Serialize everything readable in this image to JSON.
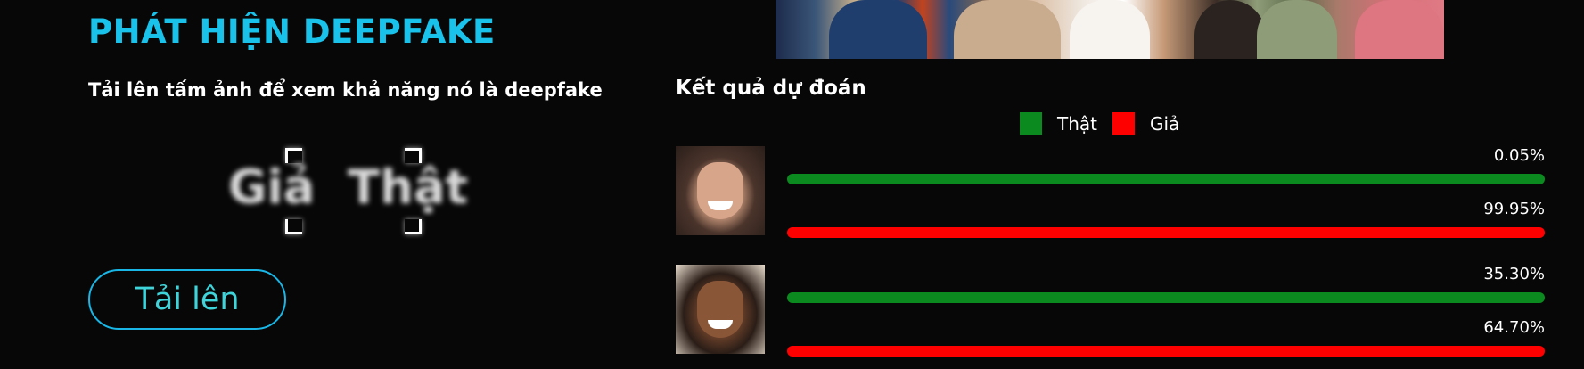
{
  "app": {
    "title": "PHÁT HIỆN DEEPFAKE",
    "subtitle": "Tải lên tấm ảnh để xem khả năng nó là deepfake"
  },
  "logo": {
    "left_word": "Giả",
    "right_word": "Thật"
  },
  "upload": {
    "label": "Tải lên"
  },
  "results": {
    "title": "Kết quả dự đoán",
    "legend": [
      {
        "label": "Thật",
        "color": "#0b8a1f"
      },
      {
        "label": "Giả",
        "color": "#ff0000"
      }
    ],
    "items": [
      {
        "real_pct_label": "0.05%",
        "fake_pct_label": "99.95%",
        "real": 0.05,
        "fake": 99.95
      },
      {
        "real_pct_label": "35.30%",
        "fake_pct_label": "64.70%",
        "real": 35.3,
        "fake": 64.7
      }
    ]
  },
  "colors": {
    "accent": "#19c2ea",
    "real": "#0b8a1f",
    "fake": "#ff0000",
    "background": "#070707"
  }
}
